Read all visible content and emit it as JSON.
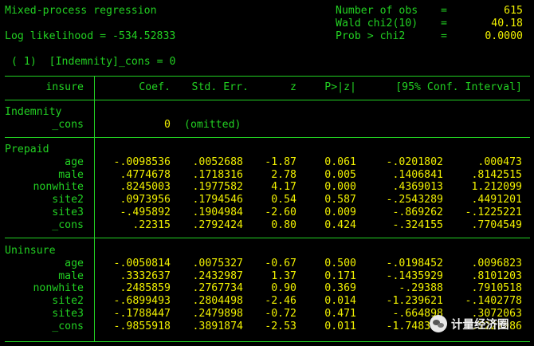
{
  "header": {
    "title": "Mixed-process regression",
    "loglik_label": "Log likelihood = -534.52833",
    "constraint": "( 1)  [Indemnity]_cons = 0",
    "stats": [
      {
        "label": "Number of obs",
        "eq": "=",
        "value": "615"
      },
      {
        "label": "Wald chi2(10)",
        "eq": "=",
        "value": "40.18"
      },
      {
        "label": "Prob > chi2",
        "eq": "=",
        "value": "0.0000"
      }
    ]
  },
  "table": {
    "columns": [
      "insure",
      "Coef.",
      "Std. Err.",
      "z",
      "P>|z|",
      "[95% Conf. Interval]"
    ],
    "groups": [
      {
        "name": "Indemnity",
        "rows": [
          {
            "var": "_cons",
            "coef": "0",
            "se": "(omitted)",
            "z": "",
            "p": "",
            "lo": "",
            "hi": ""
          }
        ]
      },
      {
        "name": "Prepaid",
        "rows": [
          {
            "var": "age",
            "coef": "-.0098536",
            "se": ".0052688",
            "z": "-1.87",
            "p": "0.061",
            "lo": "-.0201802",
            "hi": ".000473"
          },
          {
            "var": "male",
            "coef": ".4774678",
            "se": ".1718316",
            "z": "2.78",
            "p": "0.005",
            "lo": ".1406841",
            "hi": ".8142515"
          },
          {
            "var": "nonwhite",
            "coef": ".8245003",
            "se": ".1977582",
            "z": "4.17",
            "p": "0.000",
            "lo": ".4369013",
            "hi": "1.212099"
          },
          {
            "var": "site2",
            "coef": ".0973956",
            "se": ".1794546",
            "z": "0.54",
            "p": "0.587",
            "lo": "-.2543289",
            "hi": ".4491201"
          },
          {
            "var": "site3",
            "coef": "-.495892",
            "se": ".1904984",
            "z": "-2.60",
            "p": "0.009",
            "lo": "-.869262",
            "hi": "-.1225221"
          },
          {
            "var": "_cons",
            "coef": ".22315",
            "se": ".2792424",
            "z": "0.80",
            "p": "0.424",
            "lo": "-.324155",
            "hi": ".7704549"
          }
        ]
      },
      {
        "name": "Uninsure",
        "rows": [
          {
            "var": "age",
            "coef": "-.0050814",
            "se": ".0075327",
            "z": "-0.67",
            "p": "0.500",
            "lo": "-.0198452",
            "hi": ".0096823"
          },
          {
            "var": "male",
            "coef": ".3332637",
            "se": ".2432987",
            "z": "1.37",
            "p": "0.171",
            "lo": "-.1435929",
            "hi": ".8101203"
          },
          {
            "var": "nonwhite",
            "coef": ".2485859",
            "se": ".2767734",
            "z": "0.90",
            "p": "0.369",
            "lo": "-.29388",
            "hi": ".7910518"
          },
          {
            "var": "site2",
            "coef": "-.6899493",
            "se": ".2804498",
            "z": "-2.46",
            "p": "0.014",
            "lo": "-1.239621",
            "hi": "-.1402778"
          },
          {
            "var": "site3",
            "coef": "-.1788447",
            "se": ".2479898",
            "z": "-0.72",
            "p": "0.471",
            "lo": "-.664898",
            "hi": ".3072063"
          },
          {
            "var": "_cons",
            "coef": "-.9855918",
            "se": ".3891874",
            "z": "-2.53",
            "p": "0.011",
            "lo": "-1.748365",
            "hi": "-.2227986"
          }
        ]
      }
    ]
  },
  "watermark": {
    "icon": "wechat-icon",
    "text": "计量经济圈"
  },
  "colors": {
    "background": "#000000",
    "text_green": "#22d022",
    "value_yellow": "#f0f000",
    "label_white": "#f0f0f0"
  }
}
